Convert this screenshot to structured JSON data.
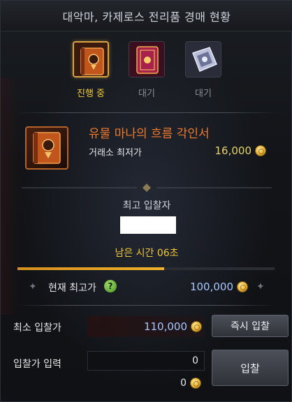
{
  "window": {
    "title": "대악마, 카제로스 전리품 경매 현황"
  },
  "tabs": [
    {
      "label": "진행 중",
      "state": "active",
      "icon": "orange-book-icon"
    },
    {
      "label": "대기",
      "state": "waiting",
      "icon": "red-ornate-book-icon"
    },
    {
      "label": "대기",
      "state": "waiting",
      "icon": "silver-book-icon"
    }
  ],
  "item": {
    "name": "유물 마나의 흐름 각인서",
    "market_label": "거래소 최저가",
    "market_price": "16,000",
    "icon": "engraving-book-icon"
  },
  "bidder": {
    "label": "최고 입찰자"
  },
  "timer": {
    "label": "남은 시간 06초",
    "progress_fraction": 0.57
  },
  "current": {
    "label": "현재 최고가",
    "help_icon": "?",
    "value": "100,000"
  },
  "min_bid": {
    "label": "최소 입찰가",
    "value": "110,000",
    "instant_button": "즉시 입찰"
  },
  "bid_input": {
    "label": "입찰가 입력",
    "value": "0",
    "total": "0",
    "bid_button": "입찰"
  },
  "colors": {
    "accent_gold": "#f4cd3a",
    "item_orange": "#f07a2c",
    "price_blue": "#a9c7ff"
  }
}
